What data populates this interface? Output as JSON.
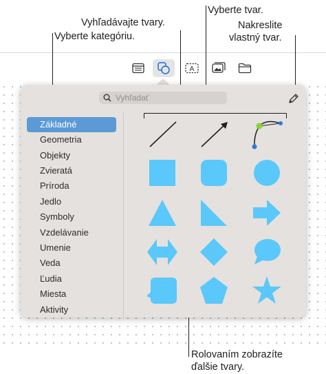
{
  "callouts": {
    "search_shapes": "Vyhľadávajte tvary.",
    "select_shape": "Vyberte tvar.",
    "draw_shape_line1": "Nakreslite",
    "draw_shape_line2": "vlastný tvar.",
    "select_category": "Vyberte kategóriu.",
    "scroll_line1": "Rolovaním zobrazíte",
    "scroll_line2": "ďalšie tvary."
  },
  "toolbar": {
    "items": [
      "table-icon",
      "shapes-icon",
      "text-box-icon",
      "media-icon",
      "folder-icon"
    ],
    "active": "shapes-icon"
  },
  "search": {
    "placeholder": "Vyhľadať",
    "value": ""
  },
  "categories": [
    "Základné",
    "Geometria",
    "Objekty",
    "Zvieratá",
    "Príroda",
    "Jedlo",
    "Symboly",
    "Vzdelávanie",
    "Umenie",
    "Veda",
    "Ľudia",
    "Miesta",
    "Aktivity"
  ],
  "selected_category": "Základné",
  "shapes": [
    "line",
    "arrow-line",
    "curve",
    "square",
    "rounded-square",
    "circle",
    "triangle",
    "right-triangle",
    "arrow",
    "double-arrow",
    "diamond",
    "speech-bubble",
    "callout-square",
    "pentagon",
    "star"
  ],
  "colors": {
    "shape_fill": "#5ac8fa",
    "selected_category": "#5b9ad5",
    "popover_bg": "#e5e1de",
    "curve_start": "#8bd33b"
  }
}
